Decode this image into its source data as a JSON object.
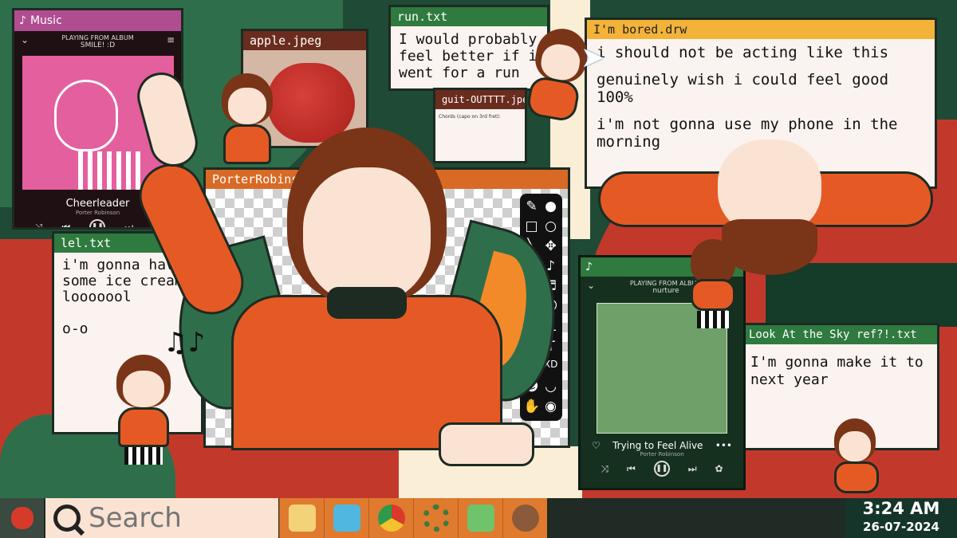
{
  "music_player_1": {
    "app_title": "Music",
    "header_label": "PLAYING FROM ALBUM",
    "album": "SMILE! :D",
    "song": "Cheerleader",
    "artist": "Porter Robinson"
  },
  "windows": {
    "run_txt": {
      "title": "run.txt",
      "text": "I would probably feel better if i went for a run"
    },
    "apple_jpeg": {
      "title": "apple.jpeg"
    },
    "guit_outfit": {
      "title": "guit-OUTTTT.jpeg",
      "caption": "Chords (capo on 3rd fret):"
    },
    "bored_drw": {
      "title": "I'm bored.drw",
      "line1": "i should not be acting like this",
      "line2": "genuinely wish i could feel good 100%",
      "line3": "i'm not gonna use my phone in the morning"
    },
    "lel_txt": {
      "title": "lel.txt",
      "text": "i'm gonna have some ice cream looooool",
      "text2": "o-o"
    },
    "paint": {
      "title": "PorterRobinson"
    },
    "sky_txt": {
      "title": "Look At the Sky ref?!.txt",
      "text": "I'm gonna make it to next year"
    }
  },
  "music_player_2": {
    "header_label": "PLAYING FROM ALBUM",
    "album": "nurture",
    "song": "Trying to Feel Alive",
    "artist": "Porter Robinson"
  },
  "taskbar": {
    "search_placeholder": "Search",
    "time": "3:24 AM",
    "date": "26-07-2024"
  },
  "colors": {
    "accent_green": "#2f7a3f",
    "accent_orange": "#e55a24",
    "accent_red": "#c2392b",
    "accent_pink": "#b04d91"
  }
}
